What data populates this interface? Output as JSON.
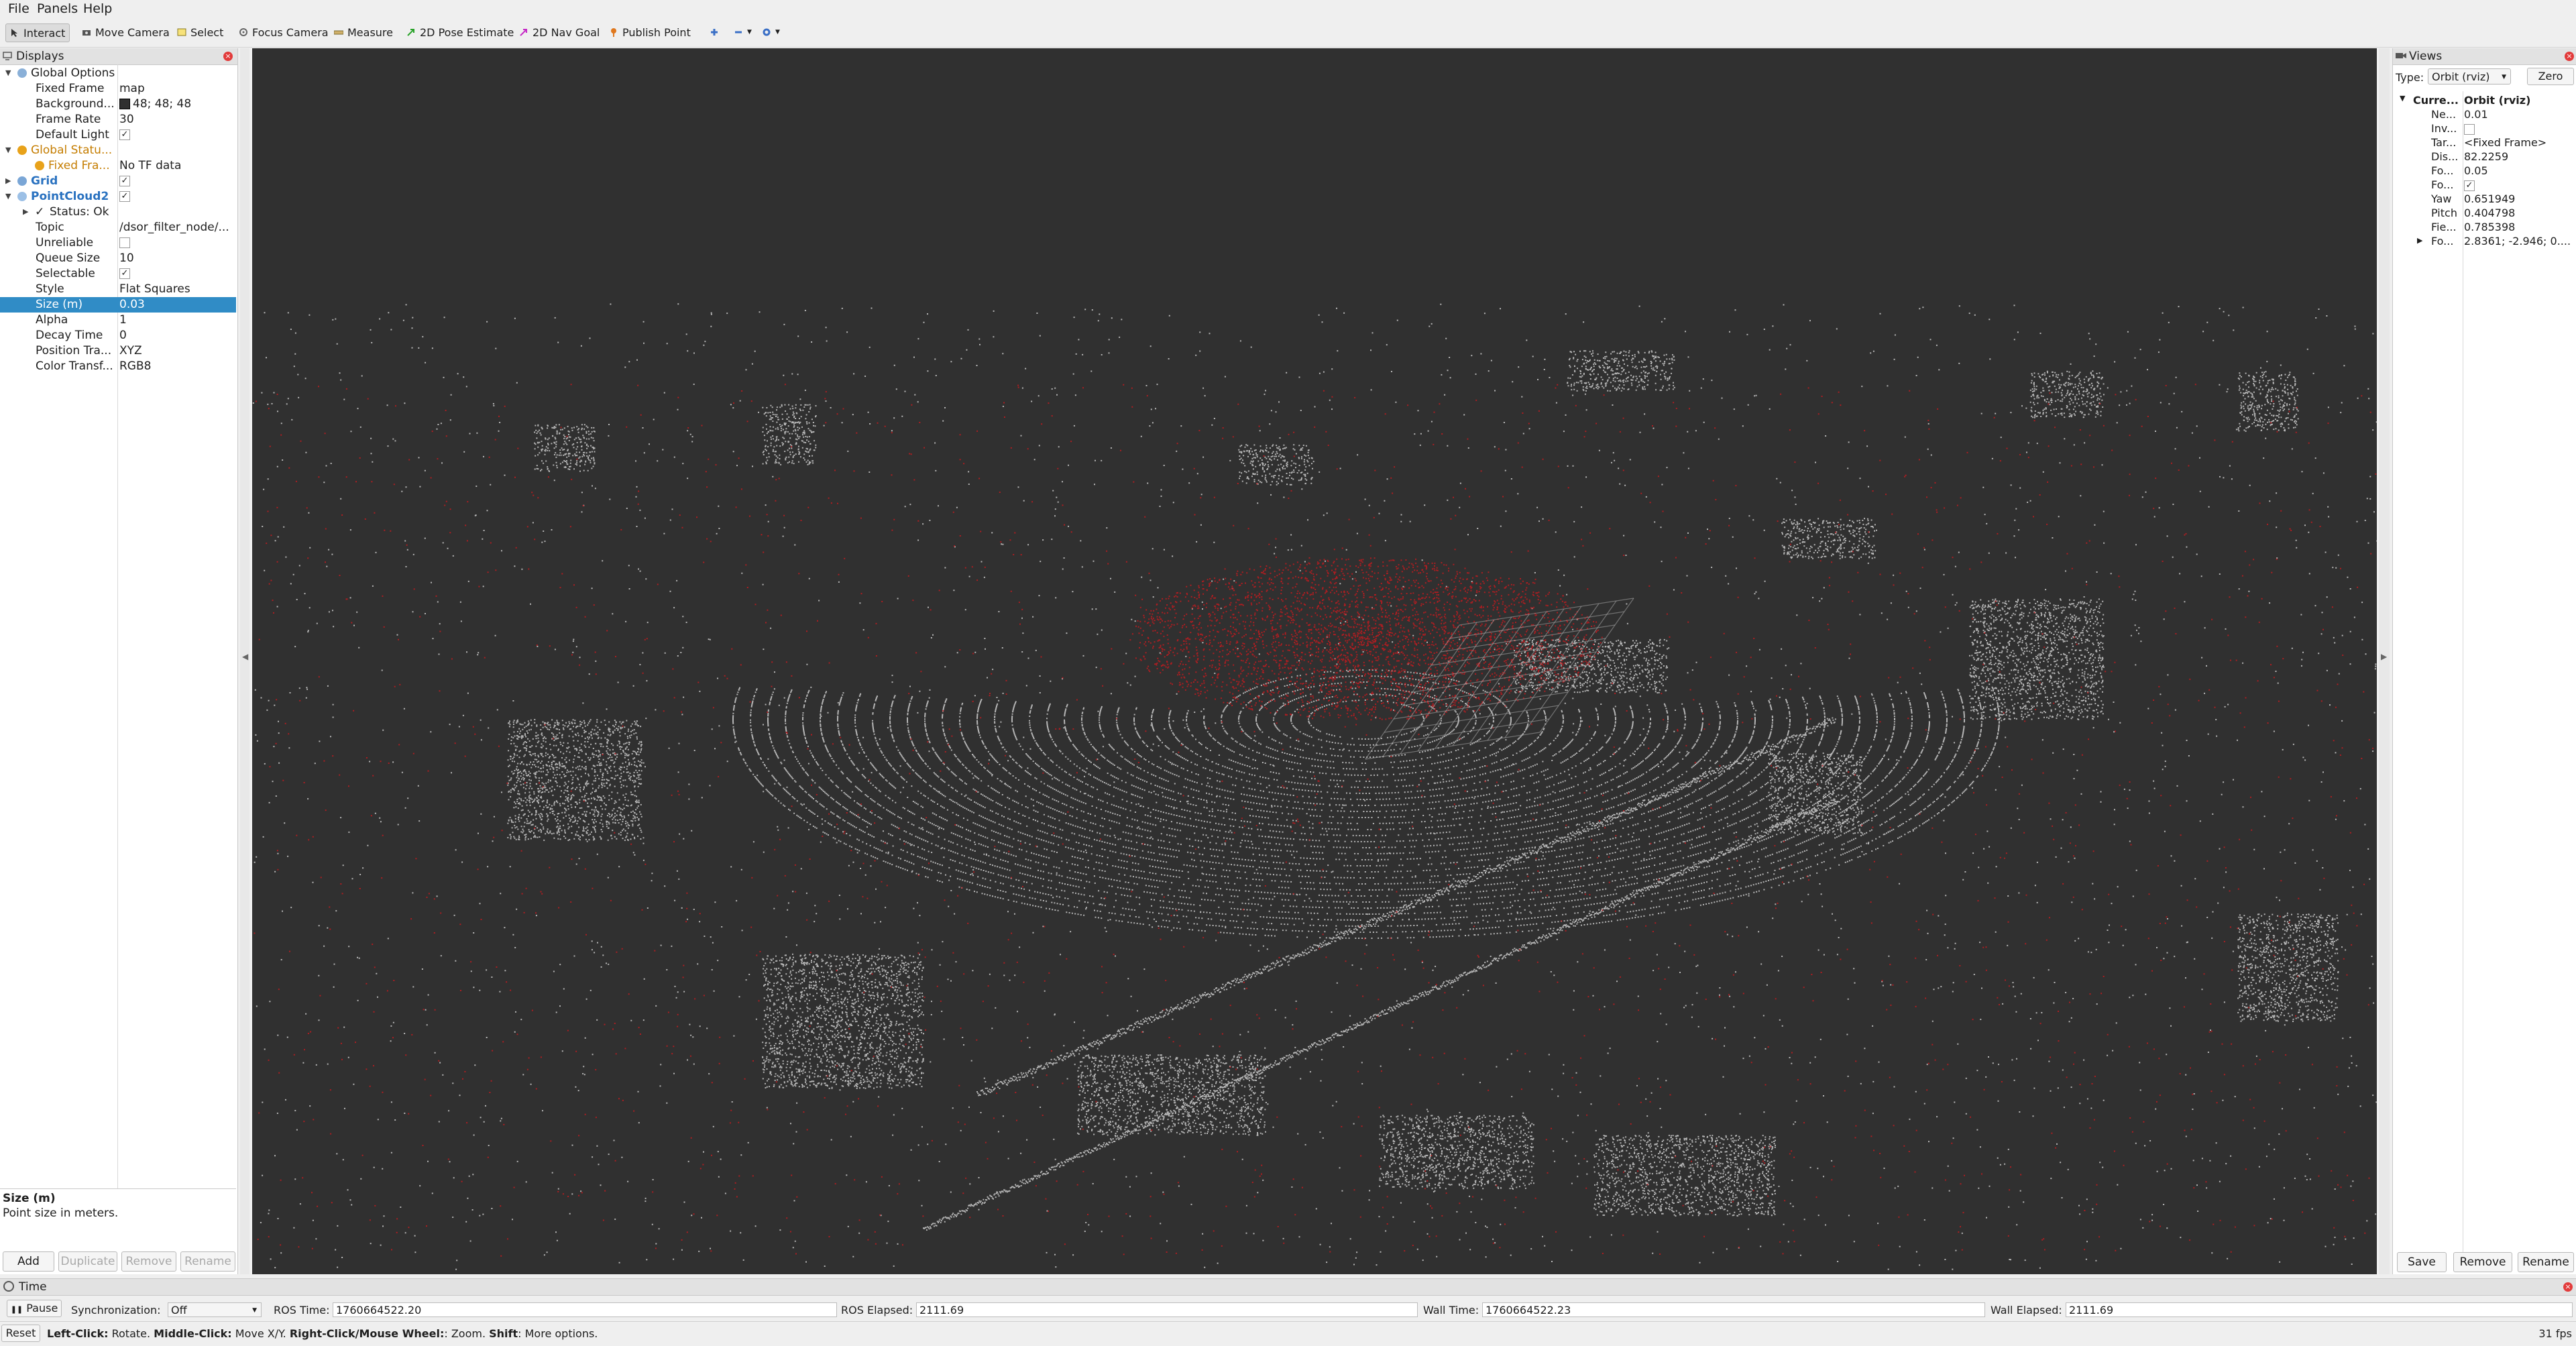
{
  "menu": {
    "file": "File",
    "panels": "Panels",
    "help": "Help"
  },
  "toolbar": {
    "interact": "Interact",
    "move_camera": "Move Camera",
    "select": "Select",
    "focus_camera": "Focus Camera",
    "measure": "Measure",
    "pose_estimate": "2D Pose Estimate",
    "nav_goal": "2D Nav Goal",
    "publish_point": "Publish Point"
  },
  "displays": {
    "title": "Displays",
    "global_options": "Global Options",
    "fixed_frame_k": "Fixed Frame",
    "fixed_frame_v": "map",
    "background_k": "Background...",
    "background_v": "48; 48; 48",
    "frame_rate_k": "Frame Rate",
    "frame_rate_v": "30",
    "default_light_k": "Default Light",
    "default_light_v": "✓",
    "global_status": "Global Statu...",
    "fixed_fra_k": "Fixed Fra...",
    "fixed_fra_v": "No TF data",
    "grid": "Grid",
    "grid_v": "✓",
    "pointcloud2": "PointCloud2",
    "pointcloud2_v": "✓",
    "status_ok": "Status: Ok",
    "topic_k": "Topic",
    "topic_v": "/dsor_filter_node/...",
    "unreliable_k": "Unreliable",
    "unreliable_v": "",
    "queue_size_k": "Queue Size",
    "queue_size_v": "10",
    "selectable_k": "Selectable",
    "selectable_v": "✓",
    "style_k": "Style",
    "style_v": "Flat Squares",
    "size_k": "Size (m)",
    "size_v": "0.03",
    "alpha_k": "Alpha",
    "alpha_v": "1",
    "decay_k": "Decay Time",
    "decay_v": "0",
    "postra_k": "Position Tra...",
    "postra_v": "XYZ",
    "colortr_k": "Color Transf...",
    "colortr_v": "RGB8",
    "desc_title": "Size (m)",
    "desc_text": "Point size in meters.",
    "add": "Add",
    "duplicate": "Duplicate",
    "remove": "Remove",
    "rename": "Rename",
    "bg_swatch_color": "#303030"
  },
  "views": {
    "title": "Views",
    "type_label": "Type:",
    "type_value": "Orbit (rviz)",
    "zero": "Zero",
    "current_k": "Curre...",
    "current_v": "Orbit (rviz)",
    "near_k": "Ne...",
    "near_v": "0.01",
    "inv_k": "Inv...",
    "inv_v": "",
    "target_k": "Tar...",
    "target_v": "<Fixed Frame>",
    "dist_k": "Dis...",
    "dist_v": "82.2259",
    "fo1_k": "Fo...",
    "fo1_v": "0.05",
    "fo2_k": "Fo...",
    "fo2_v": "✓",
    "yaw_k": "Yaw",
    "yaw_v": "0.651949",
    "pitch_k": "Pitch",
    "pitch_v": "0.404798",
    "field_k": "Fie...",
    "field_v": "0.785398",
    "focal_k": "Fo...",
    "focal_v": "2.8361; -2.946; 0....",
    "save": "Save",
    "remove": "Remove",
    "rename": "Rename"
  },
  "time": {
    "title": "Time",
    "pause": "Pause",
    "sync_label": "Synchronization:",
    "sync_value": "Off",
    "ros_time_label": "ROS Time:",
    "ros_time": "1760664522.20",
    "ros_elapsed_label": "ROS Elapsed:",
    "ros_elapsed": "2111.69",
    "wall_time_label": "Wall Time:",
    "wall_time": "1760664522.23",
    "wall_elapsed_label": "Wall Elapsed:",
    "wall_elapsed": "2111.69"
  },
  "status": {
    "reset": "Reset",
    "lc": "Left-Click:",
    "lc_t": " Rotate. ",
    "mc": "Middle-Click:",
    "mc_t": " Move X/Y. ",
    "rc": "Right-Click/Mouse Wheel:",
    "rc_t": ": Zoom. ",
    "sh": "Shift",
    "sh_t": ": More options.",
    "fps": "31 fps"
  },
  "colors": {
    "viewport_bg": "#303030",
    "points_white": "#d8d8d8",
    "points_red": "#c4161c",
    "selection": "#308cc6"
  }
}
